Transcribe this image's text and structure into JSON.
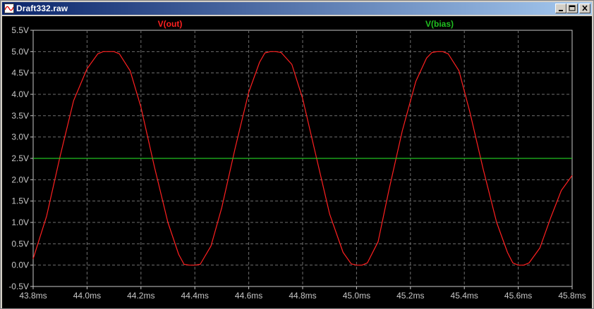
{
  "window": {
    "title": "Draft332.raw",
    "icon": "waveform-icon",
    "buttons": {
      "minimize": "minimize-icon",
      "maximize": "maximize-icon",
      "close": "close-icon"
    }
  },
  "colors": {
    "background": "#000000",
    "grid": "#6e6e6e",
    "axis_text": "#c8c8c8",
    "vout": "#ff2020",
    "vbias": "#20c020"
  },
  "chart_data": {
    "type": "line",
    "xlabel": "",
    "ylabel": "",
    "xlim": [
      43.8,
      45.8
    ],
    "ylim": [
      -0.5,
      5.5
    ],
    "x_ticks": [
      "43.8ms",
      "44.0ms",
      "44.2ms",
      "44.4ms",
      "44.6ms",
      "44.8ms",
      "45.0ms",
      "45.2ms",
      "45.4ms",
      "45.6ms",
      "45.8ms"
    ],
    "y_ticks": [
      "5.5V",
      "5.0V",
      "4.5V",
      "4.0V",
      "3.5V",
      "3.0V",
      "2.5V",
      "2.0V",
      "1.5V",
      "1.0V",
      "0.5V",
      "0.0V",
      "-0.5V"
    ],
    "grid": true,
    "series": [
      {
        "name": "V(out)",
        "color": "#ff2020",
        "x": [
          43.8,
          43.85,
          43.9,
          43.95,
          44.0,
          44.04,
          44.06,
          44.08,
          44.1,
          44.12,
          44.16,
          44.2,
          44.25,
          44.3,
          44.34,
          44.36,
          44.38,
          44.4,
          44.42,
          44.46,
          44.5,
          44.55,
          44.6,
          44.64,
          44.66,
          44.68,
          44.7,
          44.72,
          44.76,
          44.8,
          44.85,
          44.9,
          44.95,
          44.98,
          45.0,
          45.02,
          45.04,
          45.08,
          45.12,
          45.17,
          45.22,
          45.26,
          45.28,
          45.3,
          45.32,
          45.34,
          45.38,
          45.42,
          45.47,
          45.52,
          45.56,
          45.58,
          45.6,
          45.62,
          45.64,
          45.68,
          45.72,
          45.76,
          45.8
        ],
        "y": [
          0.15,
          1.15,
          2.55,
          3.85,
          4.6,
          4.95,
          5.0,
          5.0,
          5.0,
          4.95,
          4.55,
          3.7,
          2.3,
          1.0,
          0.25,
          0.02,
          0.0,
          0.0,
          0.02,
          0.45,
          1.35,
          2.75,
          4.05,
          4.75,
          4.97,
          5.0,
          5.0,
          4.98,
          4.7,
          3.9,
          2.55,
          1.2,
          0.3,
          0.03,
          0.0,
          0.0,
          0.05,
          0.55,
          1.75,
          3.15,
          4.3,
          4.85,
          4.98,
          5.0,
          5.0,
          4.95,
          4.55,
          3.6,
          2.25,
          1.0,
          0.3,
          0.05,
          0.0,
          0.0,
          0.05,
          0.4,
          1.1,
          1.75,
          2.1
        ]
      },
      {
        "name": "V(bias)",
        "color": "#20c020",
        "x": [
          43.8,
          45.8
        ],
        "y": [
          2.5,
          2.5
        ]
      }
    ]
  }
}
